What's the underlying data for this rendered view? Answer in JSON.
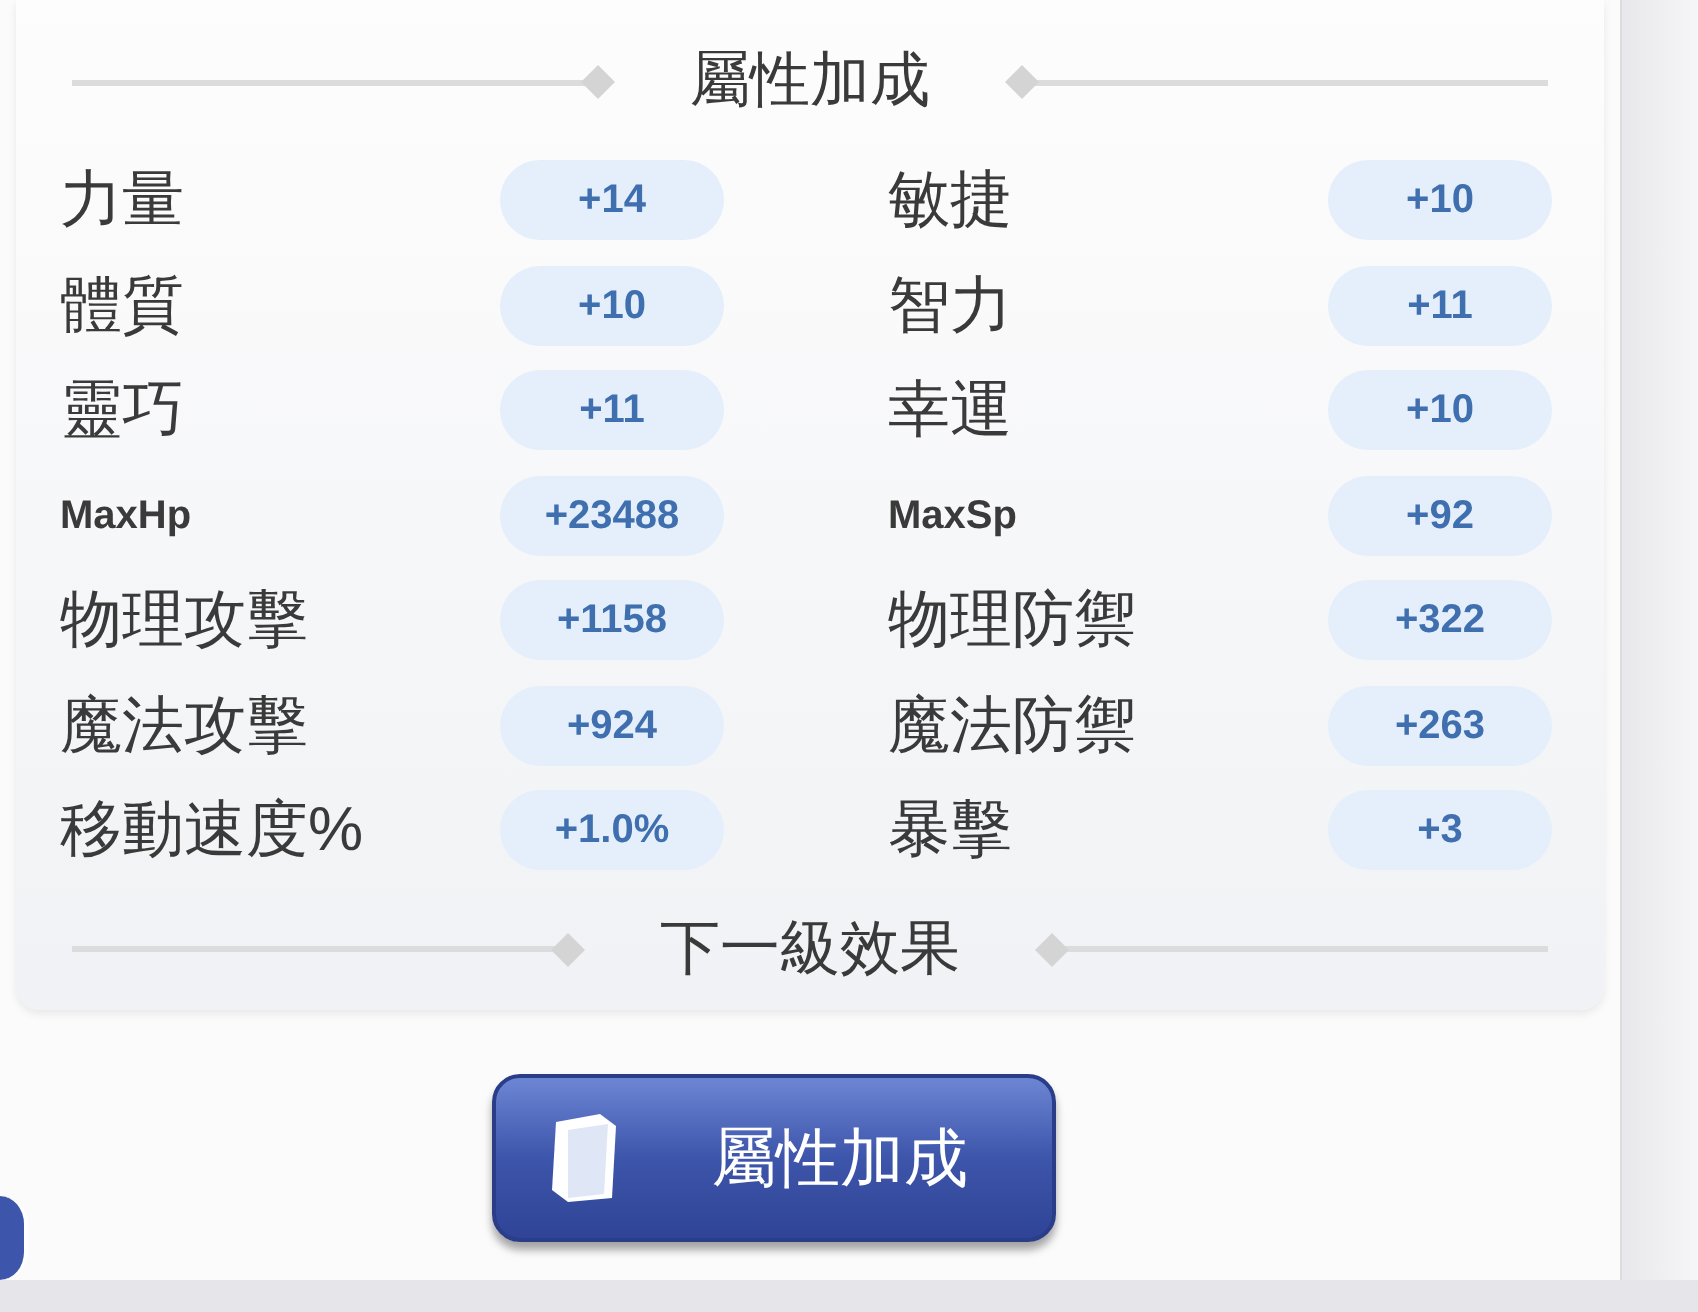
{
  "section_title": "屬性加成",
  "stats": [
    {
      "label": "力量",
      "value": "+14"
    },
    {
      "label": "敏捷",
      "value": "+10"
    },
    {
      "label": "體質",
      "value": "+10"
    },
    {
      "label": "智力",
      "value": "+11"
    },
    {
      "label": "靈巧",
      "value": "+11"
    },
    {
      "label": "幸運",
      "value": "+10"
    },
    {
      "label": "MaxHp",
      "value": "+23488",
      "kind": "latin"
    },
    {
      "label": "MaxSp",
      "value": "+92",
      "kind": "latin"
    },
    {
      "label": "物理攻擊",
      "value": "+1158"
    },
    {
      "label": "物理防禦",
      "value": "+322"
    },
    {
      "label": "魔法攻擊",
      "value": "+924"
    },
    {
      "label": "魔法防禦",
      "value": "+263"
    },
    {
      "label": "移動速度%",
      "value": "+1.0%"
    },
    {
      "label": "暴擊",
      "value": "+3"
    }
  ],
  "next_section_title": "下一級效果",
  "button": {
    "label": "屬性加成"
  }
}
